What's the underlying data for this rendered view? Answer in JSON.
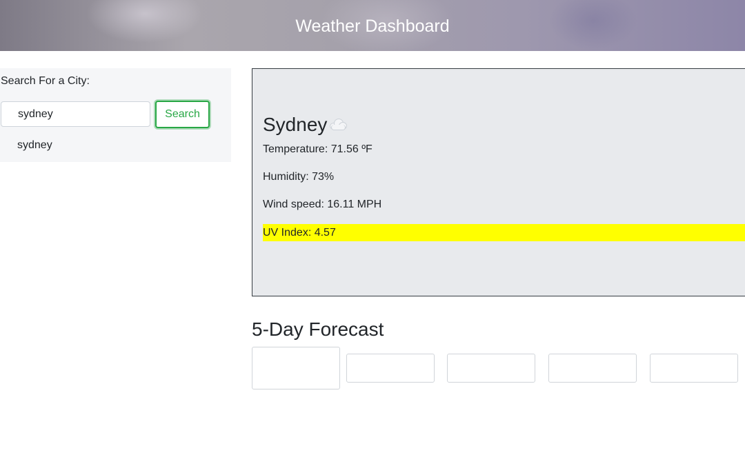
{
  "header": {
    "title": "Weather Dashboard"
  },
  "sidebar": {
    "search_label": "Search For a City:",
    "search_value": "sydney",
    "search_button": "Search",
    "history": [
      "sydney"
    ]
  },
  "current": {
    "city": "Sydney",
    "icon": "cloud-icon",
    "temperature": "Temperature: 71.56 ºF",
    "humidity": "Humidity: 73%",
    "wind": "Wind speed: 16.11 MPH",
    "uv": "UV Index: 4.57",
    "uv_color": "#ffff00"
  },
  "forecast": {
    "title": "5-Day Forecast",
    "days": [
      "",
      "",
      "",
      "",
      ""
    ]
  },
  "colors": {
    "accent": "#28a745",
    "card_bg": "#e8eaed"
  }
}
